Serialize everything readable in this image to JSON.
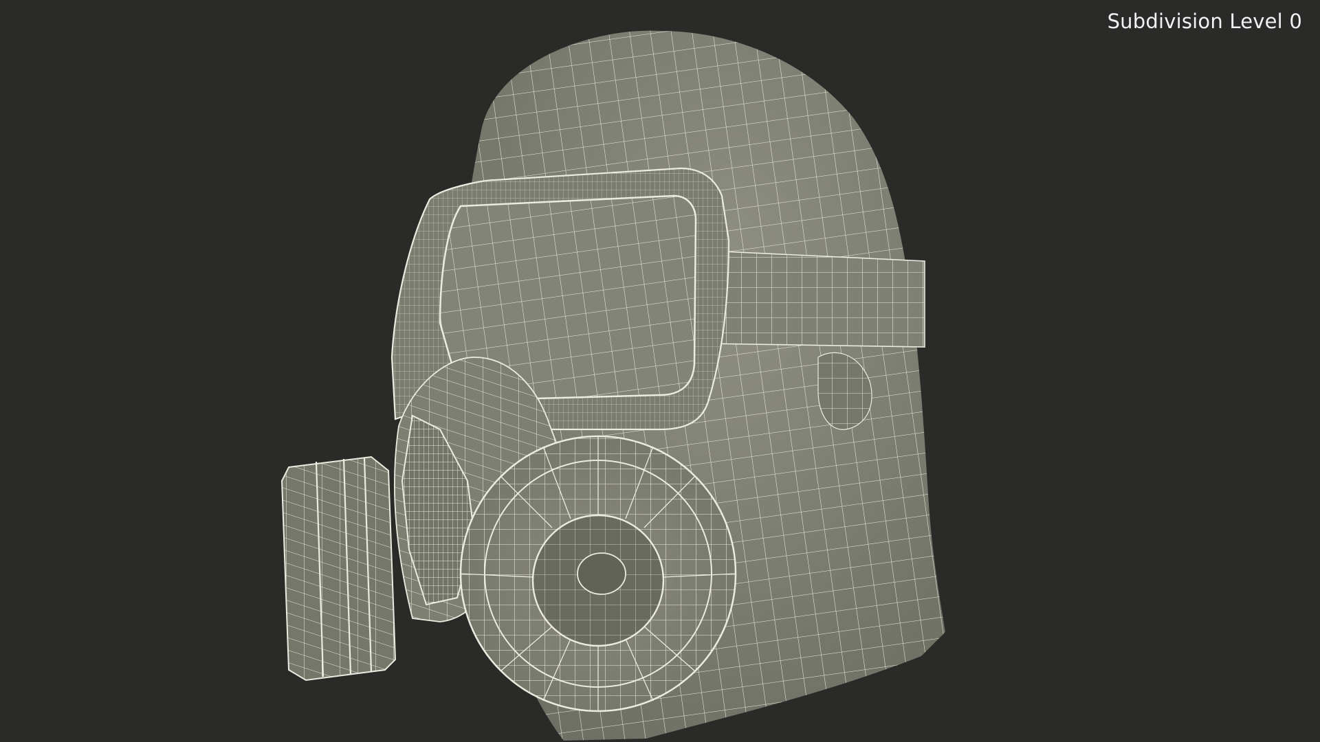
{
  "viewport": {
    "overlay_label": "Subdivision Level 0",
    "background_color": "#2a2a29",
    "mesh_fill_color": "#858678",
    "mesh_dark_color": "#6c6d62",
    "wire_color": "#ecebdf"
  },
  "scene": {
    "model": "gas-mask-head-wireframe",
    "icon": "wireframe-mesh-icon"
  }
}
